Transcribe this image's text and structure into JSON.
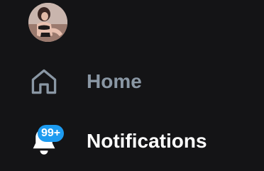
{
  "sidebar": {
    "avatar_icon": "user-avatar-photo",
    "items": [
      {
        "label": "Home",
        "icon": "home-icon",
        "color": "#8a97a4",
        "active": false
      },
      {
        "label": "Notifications",
        "icon": "bell-icon",
        "color": "#ffffff",
        "active": true,
        "badge": "99+"
      }
    ]
  },
  "colors": {
    "background": "#141416",
    "badge": "#1d9bf0",
    "inactive_text": "#8a97a4",
    "active_text": "#ffffff"
  }
}
